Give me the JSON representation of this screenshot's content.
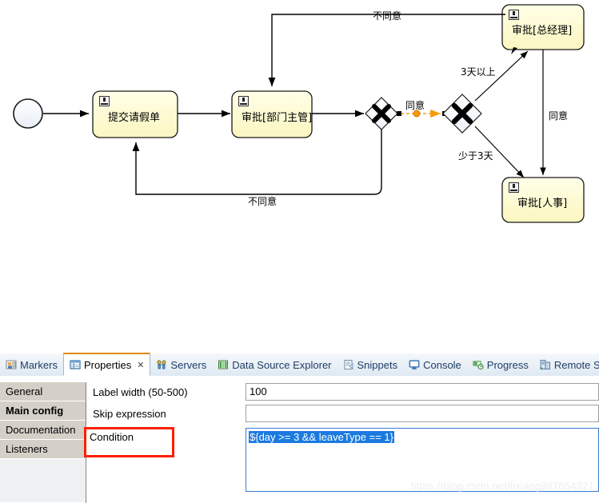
{
  "diagram": {
    "nodes": [
      {
        "id": "start",
        "type": "start-event",
        "label": ""
      },
      {
        "id": "task1",
        "type": "user-task",
        "label": "提交请假单"
      },
      {
        "id": "task2",
        "type": "user-task",
        "label": "审批[部门主管]"
      },
      {
        "id": "gw1",
        "type": "exclusive-gateway",
        "label": ""
      },
      {
        "id": "gw2",
        "type": "exclusive-gateway",
        "label": ""
      },
      {
        "id": "task3",
        "type": "user-task",
        "label": "审批[总经理]"
      },
      {
        "id": "task4",
        "type": "user-task",
        "label": "审批[人事]"
      }
    ],
    "edge_labels": {
      "top_disagree": "不同意",
      "bottom_disagree": "不同意",
      "agree_mid": "同意",
      "more_than_3days": "3天以上",
      "less_than_3days": "少于3天",
      "agree_right": "同意"
    },
    "colors": {
      "task_fill": "#ffffcc",
      "selected_flow": "#f59a0b",
      "line": "#000000"
    }
  },
  "panel": {
    "tabs": [
      {
        "label": "Markers",
        "icon": "markers-icon",
        "active": false,
        "closable": false
      },
      {
        "label": "Properties",
        "icon": "properties-icon",
        "active": true,
        "closable": true
      },
      {
        "label": "Servers",
        "icon": "servers-icon",
        "active": false,
        "closable": false
      },
      {
        "label": "Data Source Explorer",
        "icon": "database-icon",
        "active": false,
        "closable": false
      },
      {
        "label": "Snippets",
        "icon": "snippets-icon",
        "active": false,
        "closable": false
      },
      {
        "label": "Console",
        "icon": "console-icon",
        "active": false,
        "closable": false
      },
      {
        "label": "Progress",
        "icon": "progress-icon",
        "active": false,
        "closable": false
      },
      {
        "label": "Remote System",
        "icon": "remote-system-icon",
        "active": false,
        "closable": false
      }
    ],
    "close_glyph": "✕",
    "sections": [
      {
        "label": "General",
        "selected": false
      },
      {
        "label": "Main config",
        "selected": true
      },
      {
        "label": "Documentation",
        "selected": false
      },
      {
        "label": "Listeners",
        "selected": false
      }
    ],
    "fields": {
      "label_width": {
        "label": "Label width (50-500)",
        "value": "100"
      },
      "skip_expression": {
        "label": "Skip expression",
        "value": ""
      },
      "condition": {
        "label": "Condition",
        "value": "${day >= 3 && leaveType == 1}"
      }
    }
  },
  "watermark": "https://blog.csdn.net/lixiang987654321"
}
